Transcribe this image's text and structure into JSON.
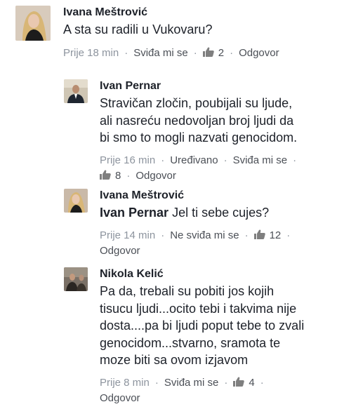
{
  "comments": [
    {
      "author": "Ivana Meštrović",
      "text": "A sta su radili u Vukovaru?",
      "time": "Prije 18 min",
      "like_action": "Sviđa mi se",
      "likes": "2",
      "reply_action": "Odgovor"
    },
    {
      "author": "Ivan Pernar",
      "text_lines": [
        "Stravičan zločin, poubijali su ljude,",
        "ali nasreću nedovoljan broj ljudi da",
        "bi smo to mogli nazvati genocidom."
      ],
      "time": "Prije 16 min",
      "edited": "Uređivano",
      "like_action": "Sviđa mi se",
      "likes": "8",
      "reply_action": "Odgovor"
    },
    {
      "author": "Ivana Meštrović",
      "mention": "Ivan Pernar",
      "text": "Jel ti sebe cujes?",
      "time": "Prije 14 min",
      "like_action": "Ne sviđa mi se",
      "likes": "12",
      "reply_action": "Odgovor"
    },
    {
      "author": "Nikola Kelić",
      "text_lines": [
        "Pa da, trebali su pobiti jos kojih",
        "tisucu ljudi...ocito tebi i takvima nije",
        "dosta....pa bi ljudi poput tebe to zvali",
        "genocidom...stvarno, sramota te",
        "moze biti sa ovom izjavom"
      ],
      "time": "Prije 8 min",
      "like_action": "Sviđa mi se",
      "likes": "4",
      "reply_action": "Odgovor"
    }
  ],
  "colors": {
    "text": "#1d2129",
    "meta": "#8d949e",
    "action": "#4b4f56",
    "like_icon": "#7f7f7f"
  },
  "icons": {
    "like": "thumbs-up-icon"
  }
}
